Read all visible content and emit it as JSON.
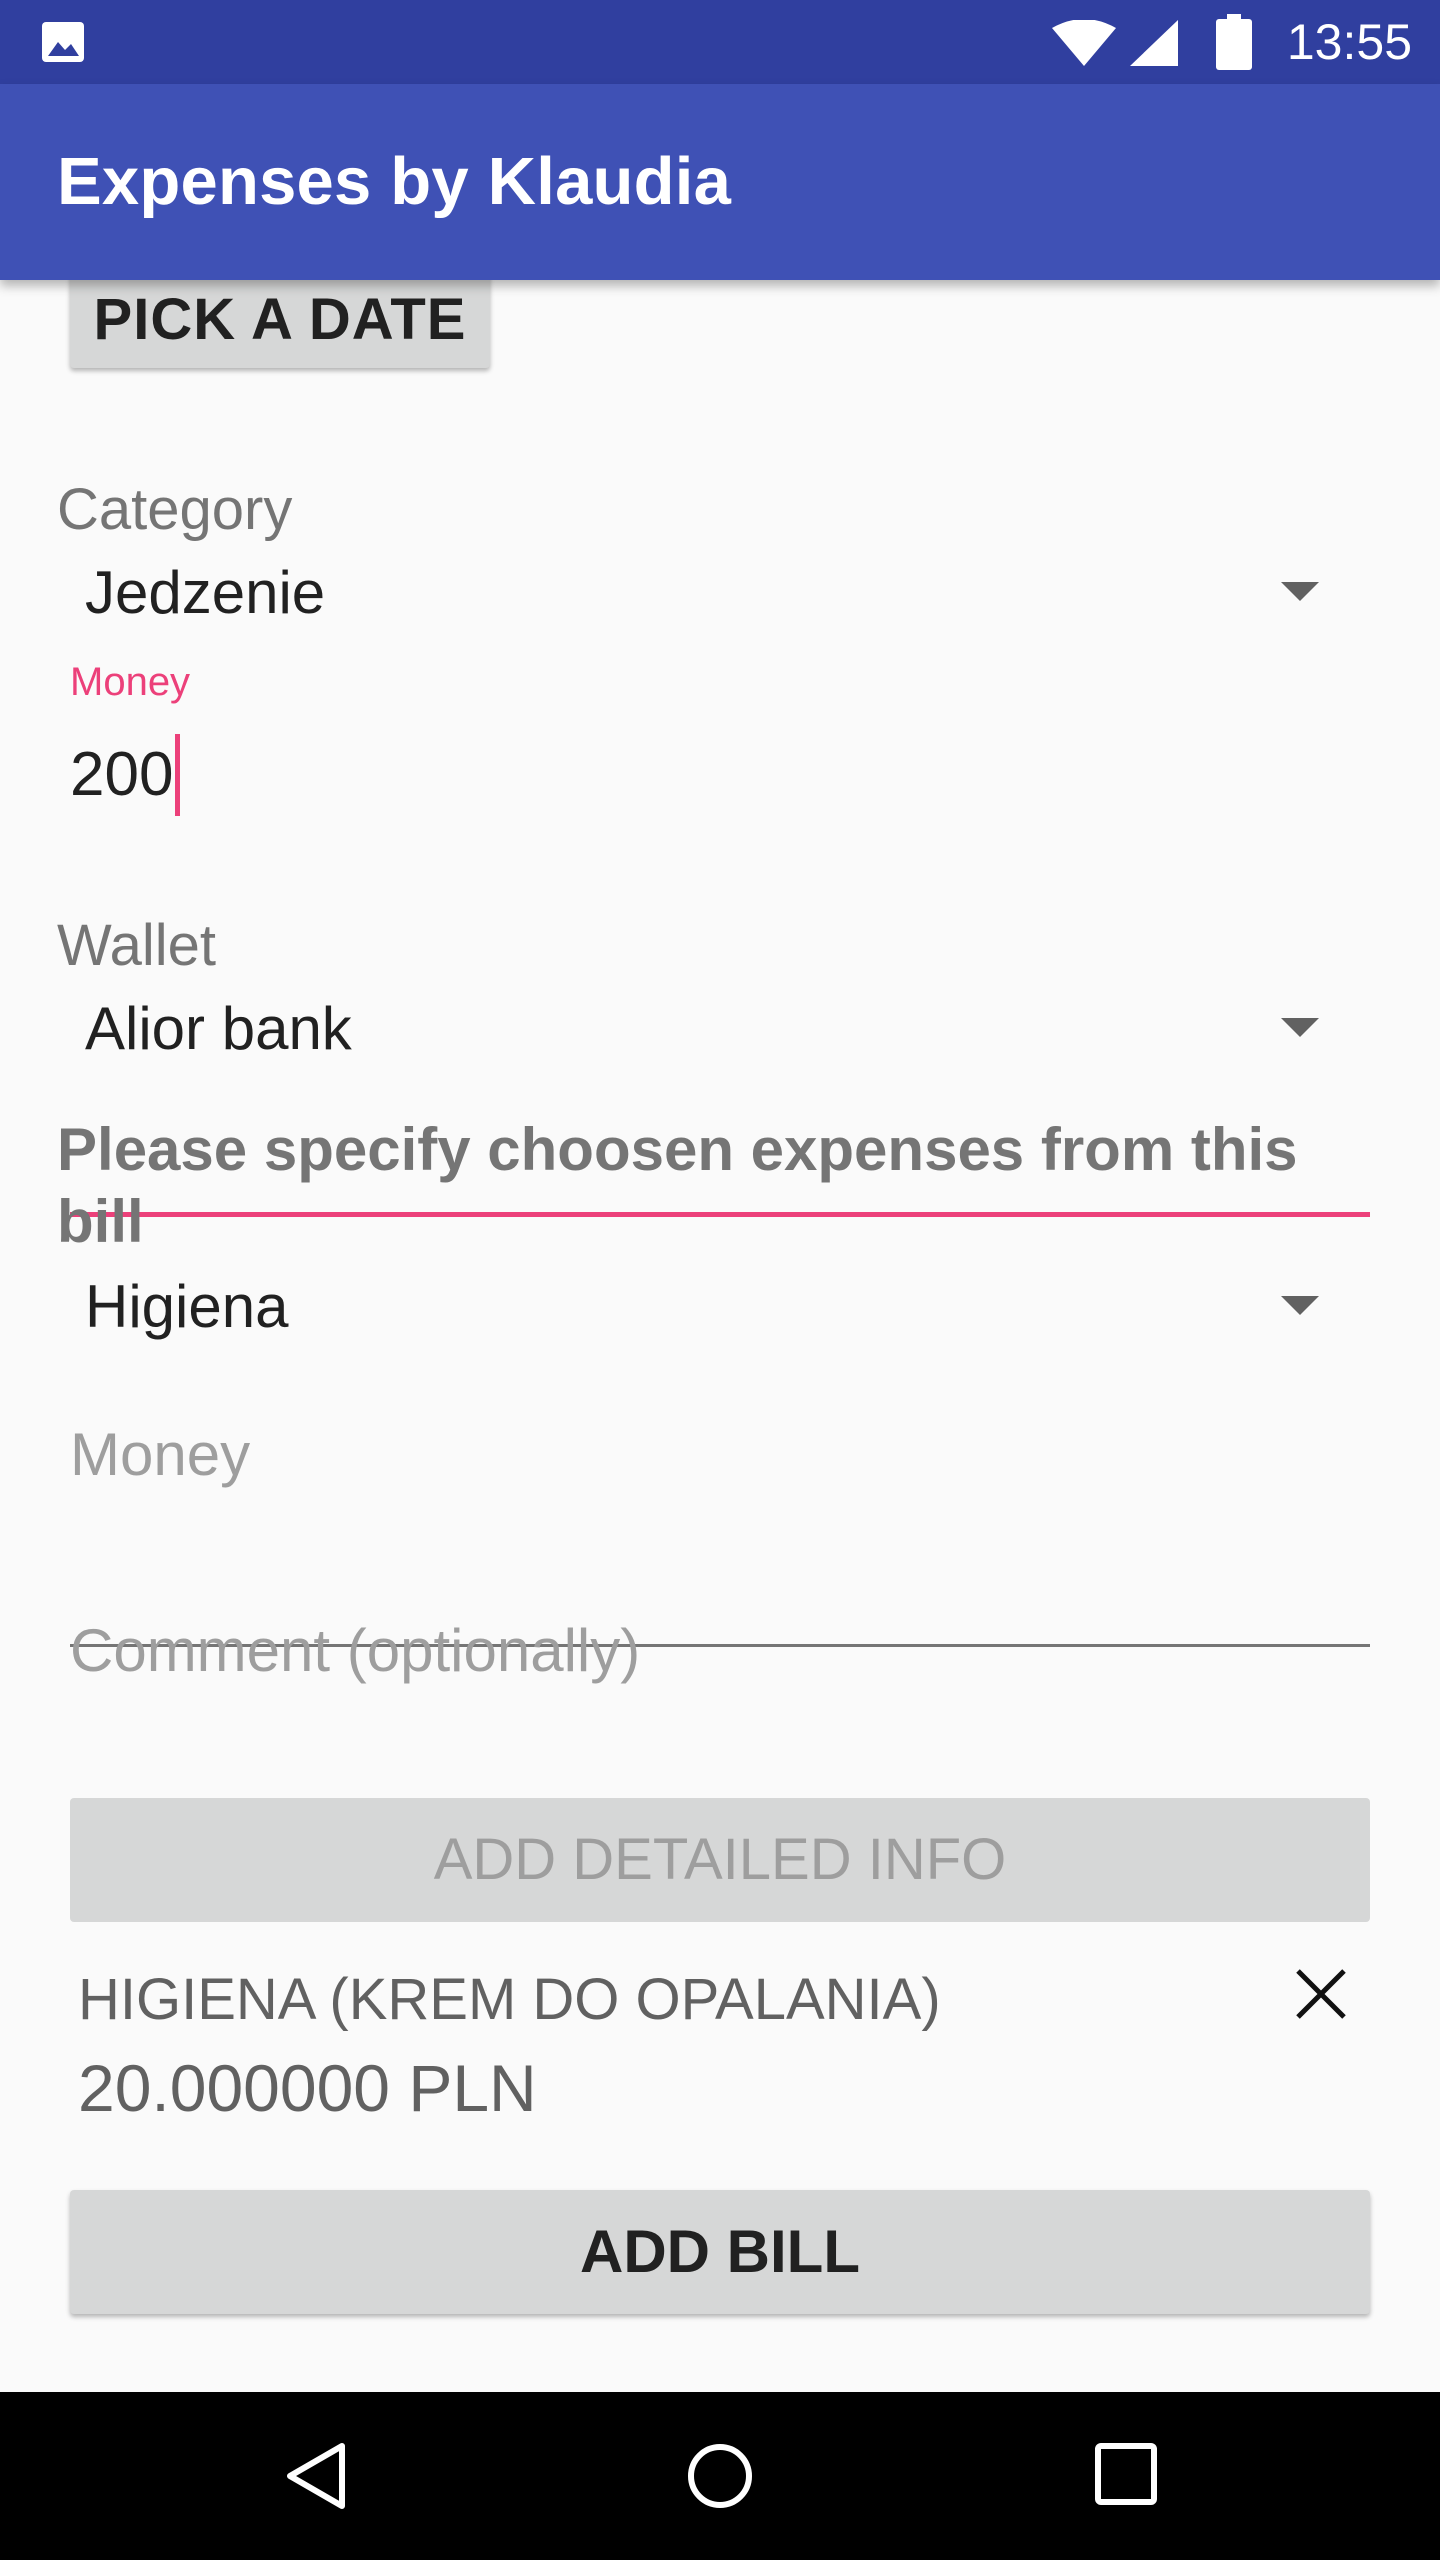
{
  "status_bar": {
    "time": "13:55",
    "icons": [
      "image-icon",
      "wifi-icon",
      "signal-icon",
      "battery-icon"
    ]
  },
  "app_bar": {
    "title": "Expenses by Klaudia"
  },
  "form": {
    "pick_date_label": "PICK A DATE",
    "category": {
      "label": "Category",
      "selected": "Jedzenie"
    },
    "money": {
      "float_label": "Money",
      "value": "200"
    },
    "wallet": {
      "label": "Wallet",
      "selected": "Alior bank"
    },
    "prompt": "Please specify choosen expenses from this bill",
    "detail_category": {
      "selected": "Higiena"
    },
    "detail_money": {
      "placeholder": "Money"
    },
    "comment": {
      "placeholder": "Comment (optionally)"
    },
    "add_detailed_label": "ADD DETAILED INFO",
    "detail_item": {
      "title": "HIGIENA (KREM DO OPALANIA)",
      "amount": "20.000000 PLN"
    },
    "add_bill_label": "ADD BILL"
  },
  "nav_bar": {
    "icons": [
      "back-icon",
      "home-icon",
      "recents-icon"
    ]
  },
  "colors": {
    "primary": "#3f51b5",
    "primary_dark": "#303f9f",
    "accent": "#ec407a"
  }
}
